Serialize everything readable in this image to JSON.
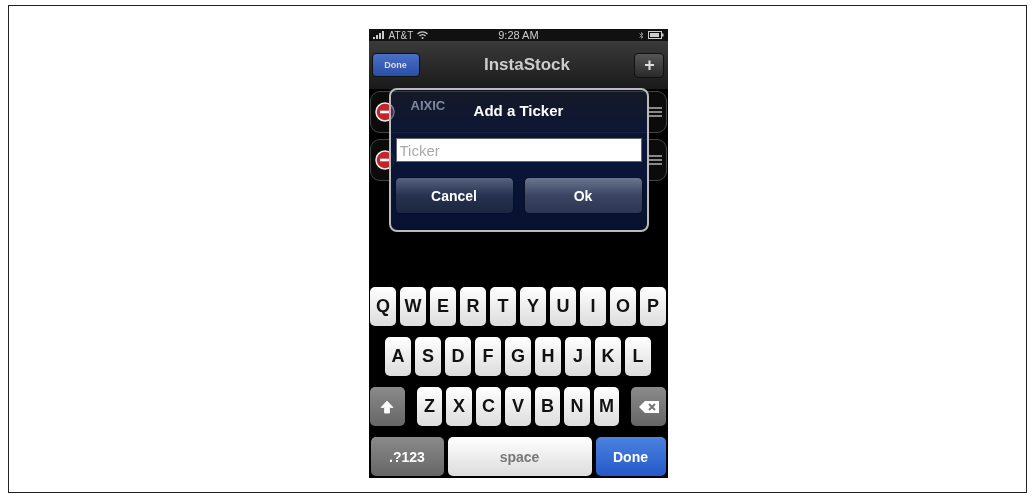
{
  "status_bar": {
    "carrier": "AT&T",
    "time": "9:28 AM"
  },
  "nav_bar": {
    "left_button": "Done",
    "title": "InstaStock",
    "right_button": "+"
  },
  "rows": [
    {
      "kind": "labeled",
      "ticker": "AIXIC"
    },
    {
      "kind": "blank"
    }
  ],
  "alert": {
    "title": "Add a Ticker",
    "field": {
      "placeholder": "Ticker"
    },
    "buttons": [
      "Cancel",
      "Ok"
    ]
  },
  "keyboard": {
    "rows": [
      {
        "keys": [
          {
            "kind": "letter",
            "label": "Q"
          },
          {
            "kind": "letter",
            "label": "W"
          },
          {
            "kind": "letter",
            "label": "E"
          },
          {
            "kind": "letter",
            "label": "R"
          },
          {
            "kind": "letter",
            "label": "T"
          },
          {
            "kind": "letter",
            "label": "Y"
          },
          {
            "kind": "letter",
            "label": "U"
          },
          {
            "kind": "letter",
            "label": "I"
          },
          {
            "kind": "letter",
            "label": "O"
          },
          {
            "kind": "letter",
            "label": "P"
          }
        ]
      },
      {
        "keys": [
          {
            "kind": "letter",
            "label": "A"
          },
          {
            "kind": "letter",
            "label": "S"
          },
          {
            "kind": "letter",
            "label": "D"
          },
          {
            "kind": "letter",
            "label": "F"
          },
          {
            "kind": "letter",
            "label": "G"
          },
          {
            "kind": "letter",
            "label": "H"
          },
          {
            "kind": "letter",
            "label": "J"
          },
          {
            "kind": "letter",
            "label": "K"
          },
          {
            "kind": "letter",
            "label": "L"
          }
        ]
      },
      {
        "keys": [
          {
            "kind": "shift"
          },
          {
            "kind": "letter",
            "label": "Z"
          },
          {
            "kind": "letter",
            "label": "X"
          },
          {
            "kind": "letter",
            "label": "C"
          },
          {
            "kind": "letter",
            "label": "V"
          },
          {
            "kind": "letter",
            "label": "B"
          },
          {
            "kind": "letter",
            "label": "N"
          },
          {
            "kind": "letter",
            "label": "M"
          },
          {
            "kind": "delete"
          }
        ]
      },
      {
        "keys": [
          {
            "kind": "mode",
            "label": ".?123"
          },
          {
            "kind": "space",
            "label": "space"
          },
          {
            "kind": "return",
            "label": "Done"
          }
        ]
      }
    ]
  }
}
